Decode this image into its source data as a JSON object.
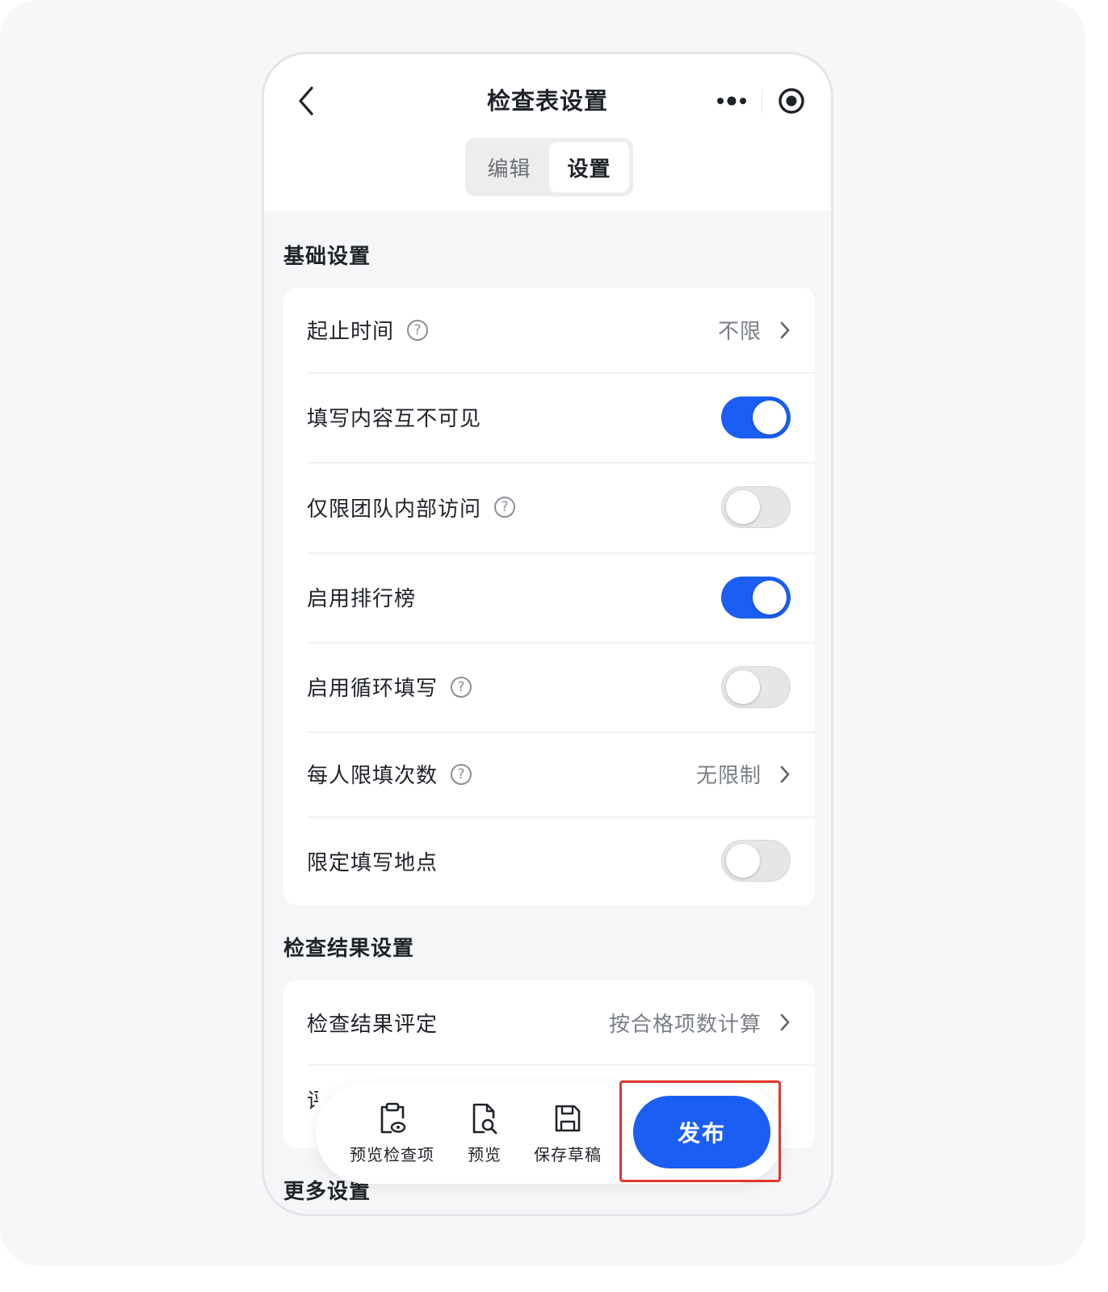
{
  "header": {
    "title": "检查表设置",
    "tabs": [
      {
        "label": "编辑",
        "active": false
      },
      {
        "label": "设置",
        "active": true
      }
    ]
  },
  "basic": {
    "title": "基础设置",
    "rows": {
      "start_end_time": {
        "label": "起止时间",
        "value": "不限"
      },
      "content_invisible": {
        "label": "填写内容互不可见",
        "on": true
      },
      "team_only": {
        "label": "仅限团队内部访问",
        "on": false
      },
      "leaderboard": {
        "label": "启用排行榜",
        "on": true
      },
      "loop_fill": {
        "label": "启用循环填写",
        "on": false
      },
      "per_person_limit": {
        "label": "每人限填次数",
        "value": "无限制"
      },
      "location_limit": {
        "label": "限定填写地点",
        "on": false
      }
    }
  },
  "result": {
    "title": "检查结果设置",
    "rows": {
      "evaluation": {
        "label": "检查结果评定",
        "value": "按合格项数计算"
      },
      "second_partial": {
        "label": "评"
      }
    }
  },
  "more": {
    "title": "更多设置"
  },
  "bottom_bar": {
    "preview_items": "预览检查项",
    "preview": "预览",
    "save_draft": "保存草稿",
    "publish": "发布"
  },
  "colors": {
    "accent": "#1b5ef3",
    "highlight": "#e0362b"
  }
}
